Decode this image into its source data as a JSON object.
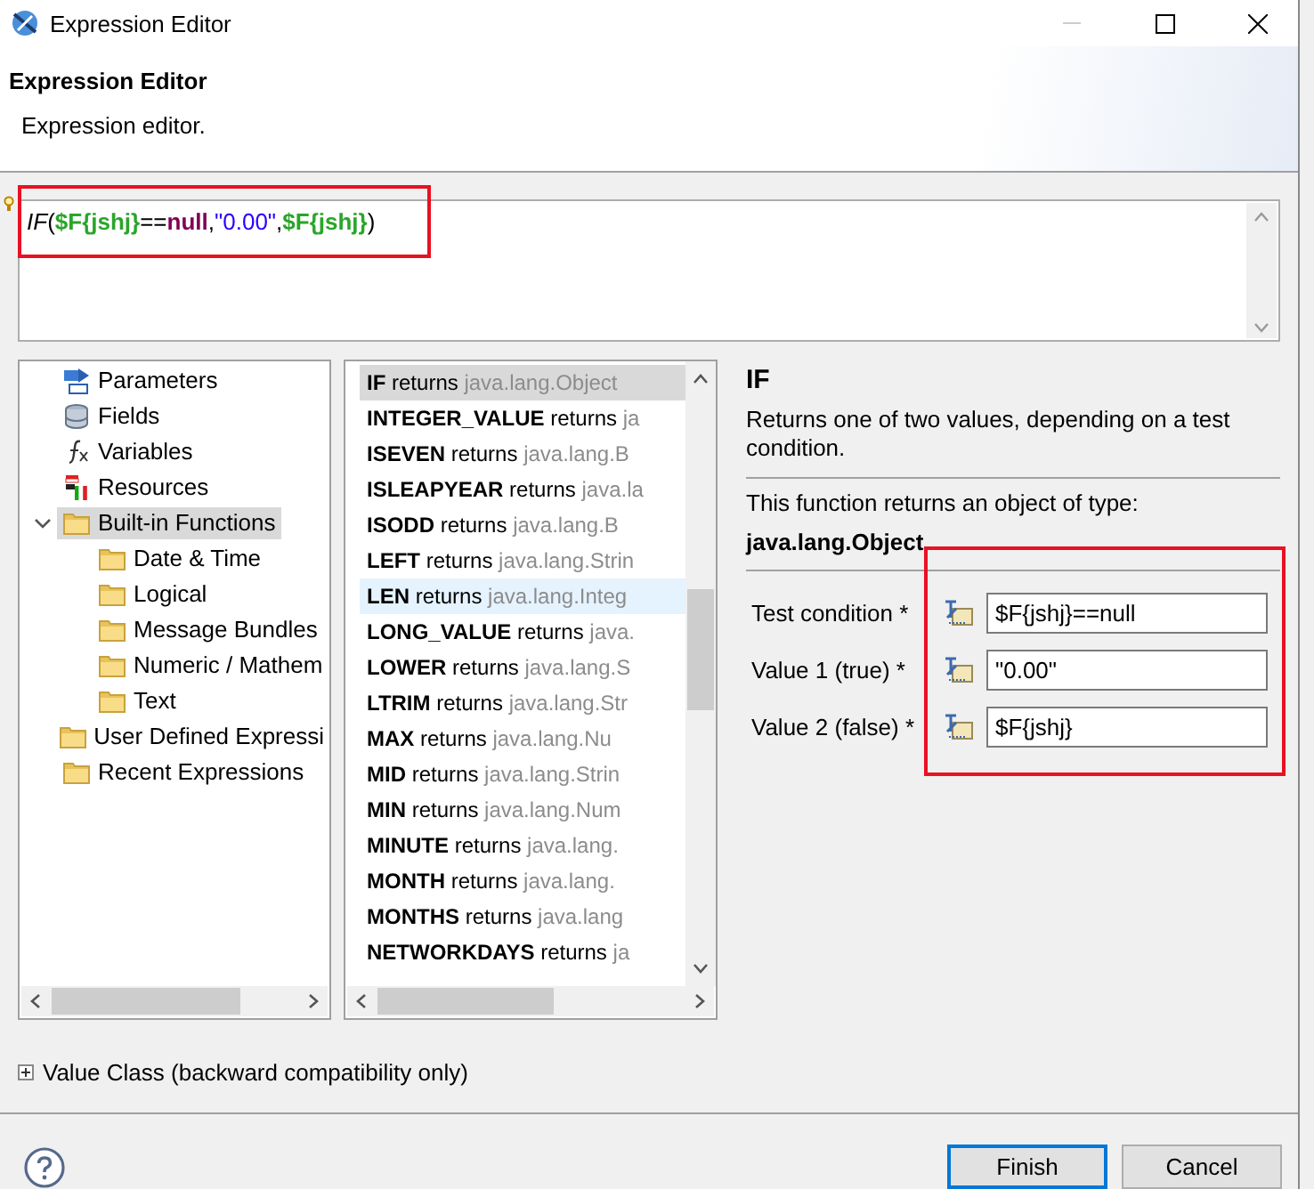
{
  "window": {
    "title": "Expression Editor"
  },
  "header": {
    "title": "Expression Editor",
    "description": "Expression editor."
  },
  "expression": {
    "tokens": [
      {
        "kind": "function",
        "text": "IF"
      },
      {
        "kind": "punct",
        "text": "("
      },
      {
        "kind": "field",
        "text": "$F{jshj}"
      },
      {
        "kind": "operator",
        "text": "=="
      },
      {
        "kind": "keyword",
        "text": "null"
      },
      {
        "kind": "punct",
        "text": ","
      },
      {
        "kind": "string",
        "text": "\"0.00\""
      },
      {
        "kind": "punct",
        "text": ","
      },
      {
        "kind": "field",
        "text": "$F{jshj}"
      },
      {
        "kind": "punct",
        "text": ")"
      }
    ]
  },
  "tree": [
    {
      "label": "Parameters",
      "kind": "parameters",
      "selected": false
    },
    {
      "label": "Fields",
      "kind": "fields",
      "selected": false
    },
    {
      "label": "Variables",
      "kind": "variables",
      "selected": false
    },
    {
      "label": "Resources",
      "kind": "resources",
      "selected": false
    },
    {
      "label": "Built-in Functions",
      "kind": "folder",
      "selected": true,
      "expanded": true,
      "children": [
        {
          "label": "Date & Time",
          "kind": "folder",
          "selected": false
        },
        {
          "label": "Logical",
          "kind": "folder",
          "selected": false
        },
        {
          "label": "Message Bundles",
          "kind": "folder",
          "selected": false
        },
        {
          "label": "Numeric / Mathem",
          "kind": "folder",
          "selected": false
        },
        {
          "label": "Text",
          "kind": "folder",
          "selected": false
        }
      ]
    },
    {
      "label": "User Defined Expressi",
      "kind": "folder",
      "selected": false
    },
    {
      "label": "Recent Expressions",
      "kind": "folder",
      "selected": false
    }
  ],
  "functions": [
    {
      "name": "IF",
      "returns": "returns",
      "type": "java.lang.Object",
      "selected": true,
      "hovered": false
    },
    {
      "name": "INTEGER_VALUE",
      "returns": "returns",
      "type": "ja",
      "selected": false,
      "hovered": false
    },
    {
      "name": "ISEVEN",
      "returns": "returns",
      "type": "java.lang.B",
      "selected": false,
      "hovered": false
    },
    {
      "name": "ISLEAPYEAR",
      "returns": "returns",
      "type": "java.la",
      "selected": false,
      "hovered": false
    },
    {
      "name": "ISODD",
      "returns": "returns",
      "type": "java.lang.B",
      "selected": false,
      "hovered": false
    },
    {
      "name": "LEFT",
      "returns": "returns",
      "type": "java.lang.Strin",
      "selected": false,
      "hovered": false
    },
    {
      "name": "LEN",
      "returns": "returns",
      "type": "java.lang.Integ",
      "selected": false,
      "hovered": true
    },
    {
      "name": "LONG_VALUE",
      "returns": "returns",
      "type": "java.",
      "selected": false,
      "hovered": false
    },
    {
      "name": "LOWER",
      "returns": "returns",
      "type": "java.lang.S",
      "selected": false,
      "hovered": false
    },
    {
      "name": "LTRIM",
      "returns": "returns",
      "type": "java.lang.Str",
      "selected": false,
      "hovered": false
    },
    {
      "name": "MAX",
      "returns": "returns",
      "type": "java.lang.Nu",
      "selected": false,
      "hovered": false
    },
    {
      "name": "MID",
      "returns": "returns",
      "type": "java.lang.Strin",
      "selected": false,
      "hovered": false
    },
    {
      "name": "MIN",
      "returns": "returns",
      "type": "java.lang.Num",
      "selected": false,
      "hovered": false
    },
    {
      "name": "MINUTE",
      "returns": "returns",
      "type": "java.lang.",
      "selected": false,
      "hovered": false
    },
    {
      "name": "MONTH",
      "returns": "returns",
      "type": "java.lang.",
      "selected": false,
      "hovered": false
    },
    {
      "name": "MONTHS",
      "returns": "returns",
      "type": "java.lang",
      "selected": false,
      "hovered": false
    },
    {
      "name": "NETWORKDAYS",
      "returns": "returns",
      "type": "ja",
      "selected": false,
      "hovered": false
    }
  ],
  "detail": {
    "title": "IF",
    "description": "Returns one of two values, depending on a test condition.",
    "returns_label": "This function returns an object of type:",
    "returns_type": "java.lang.Object",
    "params": [
      {
        "label": "Test condition *",
        "value": "$F{jshj}==null"
      },
      {
        "label": "Value 1 (true) *",
        "value": "\"0.00\""
      },
      {
        "label": "Value 2 (false) *",
        "value": "$F{jshj}"
      }
    ]
  },
  "value_class": {
    "label": "Value Class (backward compatibility only)",
    "expanded": false
  },
  "buttons": [
    {
      "label": "Finish",
      "default": true
    },
    {
      "label": "Cancel",
      "default": false
    }
  ]
}
